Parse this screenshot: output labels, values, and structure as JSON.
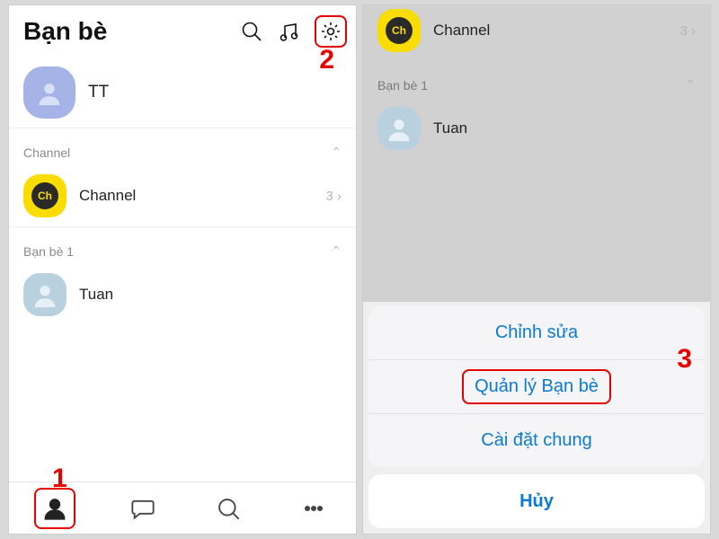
{
  "left": {
    "title": "Bạn bè",
    "profile_name": "TT",
    "section_channel": "Channel",
    "section_friends": "Bạn bè 1",
    "channel_row": {
      "name": "Channel",
      "count": "3"
    },
    "friend_row": {
      "name": "Tuan"
    }
  },
  "right": {
    "channel_row": {
      "name": "Channel",
      "count": "3"
    },
    "section_friends": "Bạn bè 1",
    "friend_row": {
      "name": "Tuan"
    },
    "sheet": {
      "opt1": "Chỉnh sửa",
      "opt2": "Quản lý Bạn bè",
      "opt3": "Cài đặt chung",
      "cancel": "Hủy"
    }
  },
  "annotations": {
    "a1": "1",
    "a2": "2",
    "a3": "3"
  },
  "icons": {
    "channel_badge": "Ch"
  }
}
